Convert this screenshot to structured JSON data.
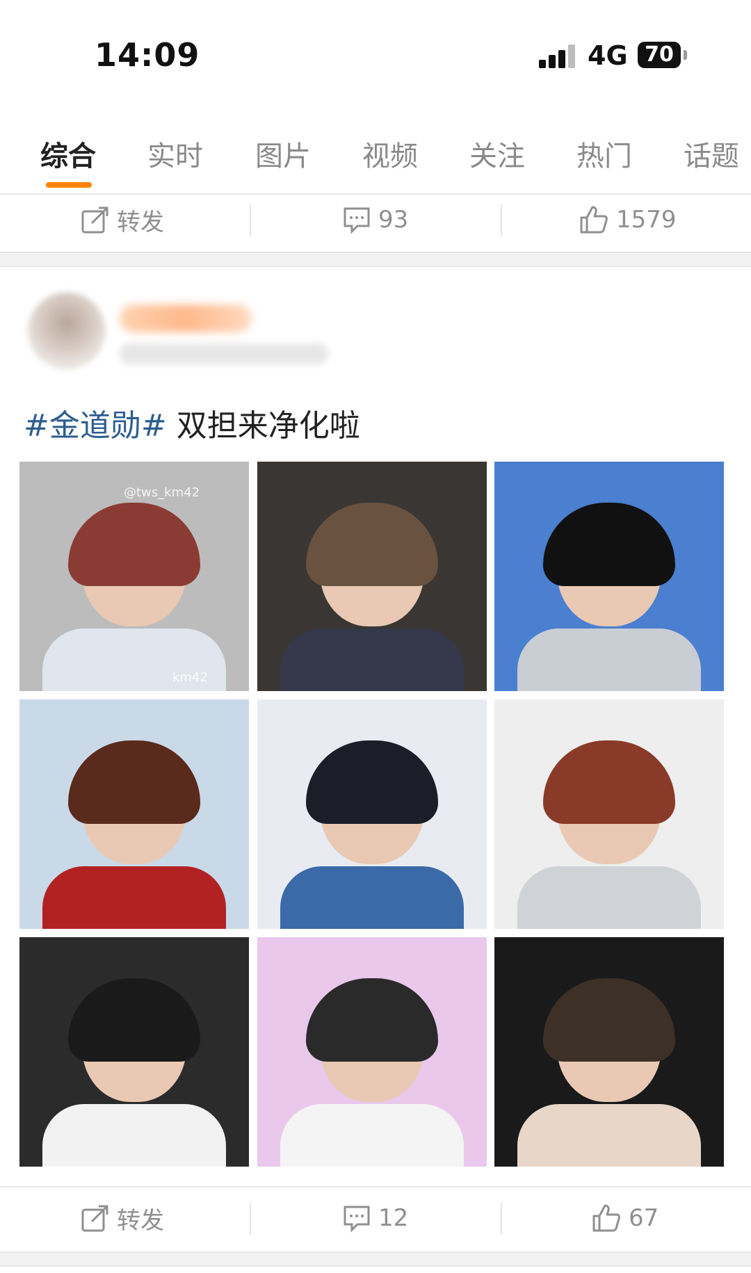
{
  "status_bar": {
    "time": "14:09",
    "network": "4G",
    "battery": "70"
  },
  "tabs": [
    {
      "label": "综合",
      "active": true
    },
    {
      "label": "实时"
    },
    {
      "label": "图片"
    },
    {
      "label": "视频"
    },
    {
      "label": "关注"
    },
    {
      "label": "热门"
    },
    {
      "label": "话题"
    }
  ],
  "prev_post_actions": {
    "repost": "转发",
    "comments": "93",
    "likes": "1579"
  },
  "post": {
    "hashtag": "#金道勋#",
    "text": " 双担来净化啦",
    "images": [
      {
        "name": "photo-1",
        "watermark": "@tws_km42",
        "watermark2": "km42",
        "colors": [
          "#bcbcbc",
          "#8a3b33",
          "#dfe6ee"
        ]
      },
      {
        "name": "photo-2",
        "colors": [
          "#3a3633",
          "#6a5240",
          "#34384a"
        ]
      },
      {
        "name": "photo-3",
        "colors": [
          "#4b7fcf",
          "#111111",
          "#c9cdd4"
        ]
      },
      {
        "name": "photo-4",
        "colors": [
          "#c9d9e8",
          "#5a2a1c",
          "#b22222"
        ]
      },
      {
        "name": "photo-5",
        "colors": [
          "#e8ecf2",
          "#1d1d2a",
          "#3b6aa8"
        ]
      },
      {
        "name": "photo-6",
        "colors": [
          "#eeeeee",
          "#8a3a28",
          "#cfd2d6"
        ]
      },
      {
        "name": "photo-7",
        "colors": [
          "#2b2b2b",
          "#1a1a1a",
          "#f2f2f2"
        ]
      },
      {
        "name": "photo-8",
        "colors": [
          "#e9c8ec",
          "#2a2a2a",
          "#f4f4f4"
        ]
      },
      {
        "name": "photo-9",
        "colors": [
          "#1a1a1a",
          "#3d3026",
          "#e8d6c8"
        ]
      }
    ]
  },
  "post_actions": {
    "repost": "转发",
    "comments": "12",
    "likes": "67"
  },
  "colors": {
    "accent": "#ff8200",
    "hashtag": "#2c5d8f"
  }
}
